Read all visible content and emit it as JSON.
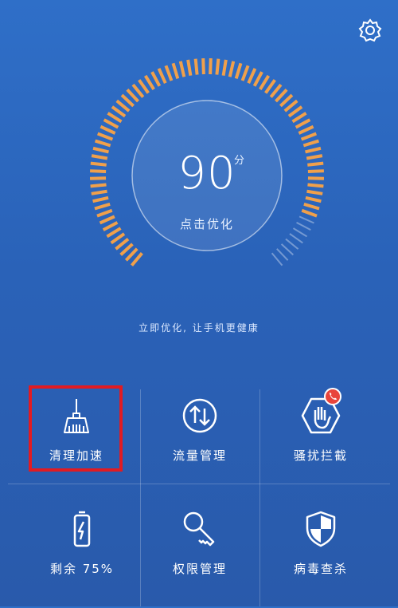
{
  "header": {
    "settings_icon": "gear-icon"
  },
  "score": {
    "value": "90",
    "unit": "分",
    "action_label": "点击优化",
    "tagline": "立即优化, 让手机更健康",
    "arc_color": "#f0a04b"
  },
  "tools": [
    {
      "label": "清理加速",
      "icon": "broom-icon"
    },
    {
      "label": "流量管理",
      "icon": "data-traffic-icon"
    },
    {
      "label": "骚扰拦截",
      "icon": "hand-block-icon"
    },
    {
      "label": "剩余 75%",
      "icon": "battery-icon"
    },
    {
      "label": "权限管理",
      "icon": "key-icon"
    },
    {
      "label": "病毒查杀",
      "icon": "shield-icon"
    }
  ],
  "annotation": {
    "highlight_color": "#e11b22"
  }
}
